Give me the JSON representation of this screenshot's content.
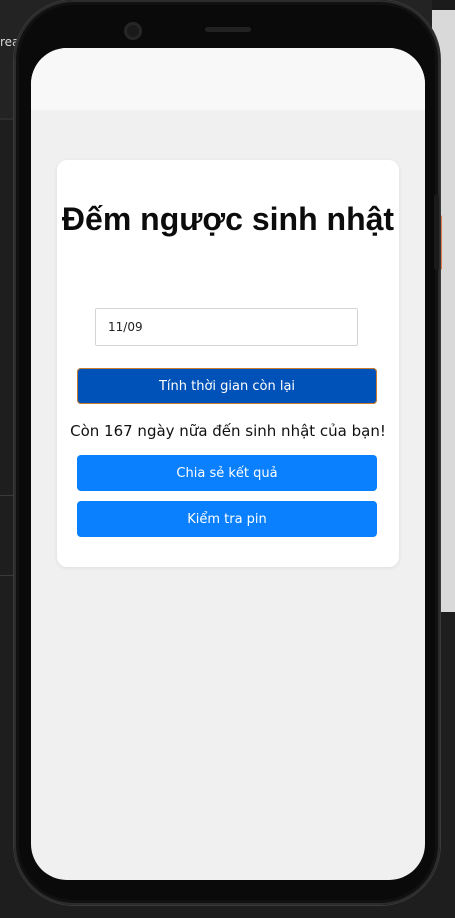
{
  "background": {
    "left_label": "rea"
  },
  "app": {
    "title": "Đếm ngược sinh nhật",
    "date_input": {
      "value": "11/09",
      "placeholder": ""
    },
    "calc_button": "Tính thời gian còn lại",
    "result_text": "Còn 167 ngày nữa đến sinh nhật của bạn!",
    "share_button": "Chia sẻ kết quả",
    "battery_button": "Kiểm tra pin"
  },
  "colors": {
    "primary_dark": "#0052b8",
    "primary": "#0a80fe",
    "screen_bg": "#f0f0f0",
    "card_bg": "#ffffff"
  }
}
